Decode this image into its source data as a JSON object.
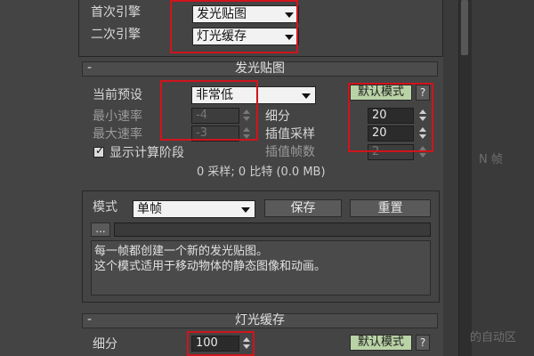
{
  "top": {
    "primary_label": "首次引擎",
    "primary_value": "发光贴图",
    "secondary_label": "二次引擎",
    "secondary_value": "灯光缓存"
  },
  "irradiance": {
    "title": "发光贴图",
    "preset_label": "当前预设",
    "preset_value": "非常低",
    "default_mode_label": "默认模式",
    "help_label": "?",
    "min_rate_label": "最小速率",
    "min_rate_value": "-4",
    "max_rate_label": "最大速率",
    "max_rate_value": "-3",
    "subdivs_label": "细分",
    "subdivs_value": "20",
    "interp_samples_label": "插值采样",
    "interp_samples_value": "20",
    "interp_frames_label": "插值帧数",
    "interp_frames_value": "2",
    "show_calc_label": "显示计算阶段",
    "show_calc_checked": true,
    "stats_text": "0 采样; 0 比特 (0.0 MB)"
  },
  "mode": {
    "label": "模式",
    "value": "单帧",
    "save_label": "保存",
    "reset_label": "重置",
    "browse_label": "...",
    "description_line1": "每一帧都创建一个新的发光贴图。",
    "description_line2": "这个模式适用于移动物体的静态图像和动画。"
  },
  "light_cache": {
    "title": "灯光缓存",
    "subdivs_label": "细分",
    "subdivs_value": "100",
    "default_mode_label": "默认模式",
    "help_label": "?"
  },
  "background_ghost": {
    "n_frame": "N 帧",
    "auto_zone": "的自动区"
  },
  "colors": {
    "highlight_red": "#d0141b",
    "default_mode_green": "#b9d2a6"
  }
}
